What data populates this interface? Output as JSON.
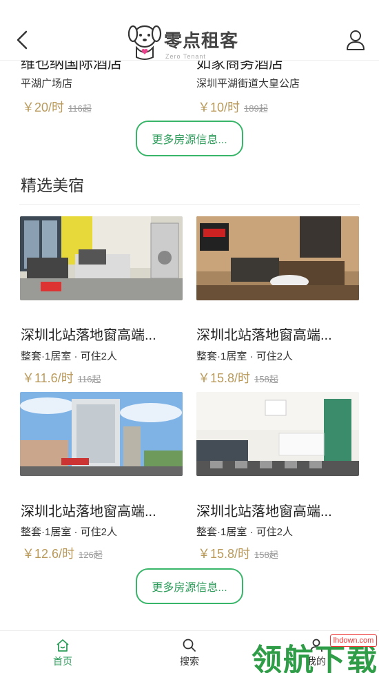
{
  "header": {
    "logo_text": "零点租客",
    "logo_sub": "Zero Tenant"
  },
  "top_listings": [
    {
      "title": "维也纳国际酒店",
      "location": "平湖广场店",
      "price": "￥20/时",
      "orig": "116起"
    },
    {
      "title": "如家商务酒店",
      "location": "深圳平湖街道大皇公店",
      "price": "￥10/时",
      "orig": "189起"
    }
  ],
  "more_button_label": "更多房源信息...",
  "section": {
    "title": "精选美宿"
  },
  "listings": [
    {
      "title": "深圳北站落地窗高端...",
      "details": "整套·1居室 · 可住2人",
      "price": "￥11.6/时",
      "orig": "116起"
    },
    {
      "title": "深圳北站落地窗高端...",
      "details": "整套·1居室 · 可住2人",
      "price": "￥15.8/时",
      "orig": "158起"
    },
    {
      "title": "深圳北站落地窗高端...",
      "details": "整套·1居室 · 可住2人",
      "price": "￥12.6/时",
      "orig": "126起"
    },
    {
      "title": "深圳北站落地窗高端...",
      "details": "整套·1居室 · 可住2人",
      "price": "￥15.8/时",
      "orig": "158起"
    }
  ],
  "nav": [
    {
      "label": "首页",
      "icon": "home-icon",
      "active": true
    },
    {
      "label": "搜索",
      "icon": "search-icon",
      "active": false
    },
    {
      "label": "我的",
      "icon": "user-icon",
      "active": false
    }
  ],
  "watermark": {
    "text": "领航下载",
    "url": "lhdown.com"
  },
  "colors": {
    "accent": "#2e9d5b",
    "price": "#b99a5b"
  }
}
